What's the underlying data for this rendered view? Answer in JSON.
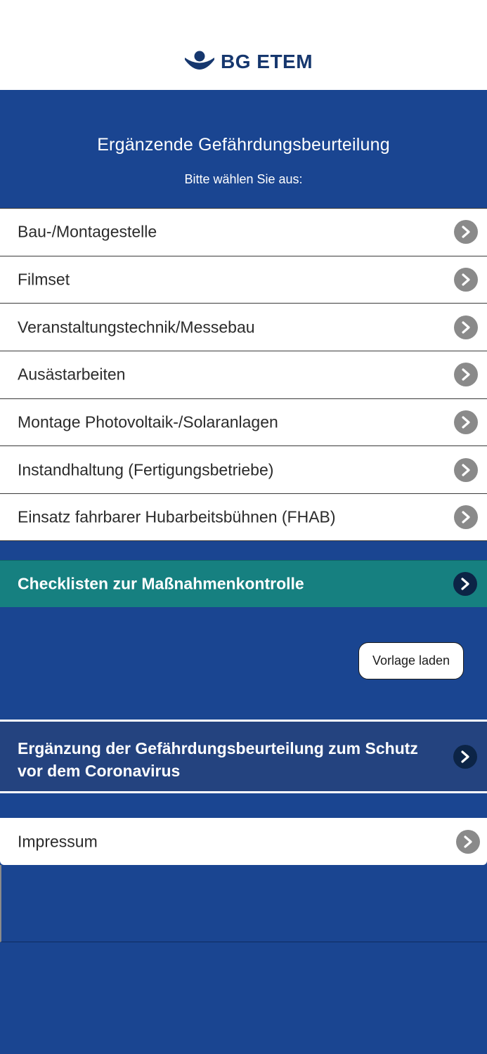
{
  "brand": {
    "name": "BG ETEM",
    "logo_icon": "bg-etem-logo-icon",
    "color": "#1a4591"
  },
  "header": {
    "title": "Ergänzende Gefährdungsbeurteilung",
    "subtitle": "Bitte wählen Sie aus:"
  },
  "menu": {
    "items": [
      {
        "label": "Bau-/Montagestelle"
      },
      {
        "label": "Filmset"
      },
      {
        "label": "Veranstaltungstechnik/Messebau"
      },
      {
        "label": "Ausästarbeiten"
      },
      {
        "label": "Montage Photovoltaik-/Solaranlagen"
      },
      {
        "label": "Instandhaltung (Fertigungsbetriebe)"
      },
      {
        "label": "Einsatz fahrbarer Hubarbeitsbühnen (FHAB)"
      }
    ]
  },
  "checklisten": {
    "label": "Checklisten zur Maßnahmenkontrolle",
    "color": "#168080"
  },
  "vorlage": {
    "label": "Vorlage laden"
  },
  "corona": {
    "label": "Ergänzung der Gefährdungsbeurteilung zum Schutz vor dem Coronavirus"
  },
  "impressum": {
    "label": "Impressum"
  },
  "icons": {
    "chevron": "chevron-right-icon"
  }
}
